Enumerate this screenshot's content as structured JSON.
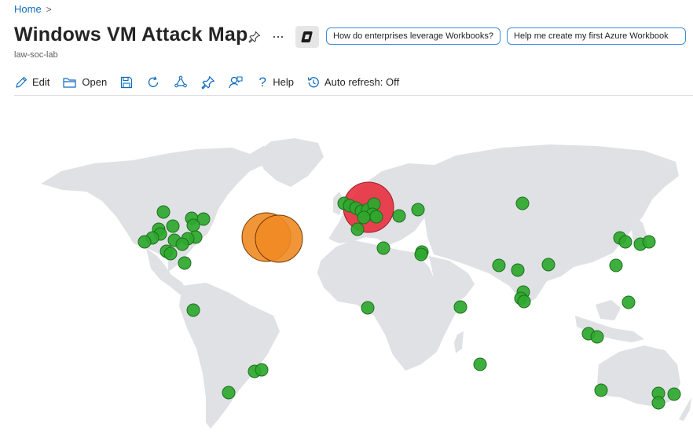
{
  "breadcrumb": {
    "home": "Home"
  },
  "header": {
    "title": "Windows VM Attack Map",
    "subtitle": "law-soc-lab",
    "prompts": [
      "How do enterprises leverage Workbooks?",
      "Help me create my first Azure Workbook"
    ]
  },
  "toolbar": {
    "edit": "Edit",
    "open": "Open",
    "help": "Help",
    "auto_refresh": "Auto refresh: Off"
  },
  "colors": {
    "accent": "#0f6cbd",
    "land": "#dfe1e4",
    "green_point": "#2ea82e",
    "red_point": "#e8303f",
    "orange_point": "#f08a24"
  },
  "icons": [
    "pin-icon",
    "more-icon",
    "copilot-icon",
    "edit-icon",
    "open-icon",
    "save-icon",
    "refresh-icon",
    "share-icon",
    "pin-icon",
    "feedback-icon",
    "help-icon",
    "history-icon"
  ]
}
